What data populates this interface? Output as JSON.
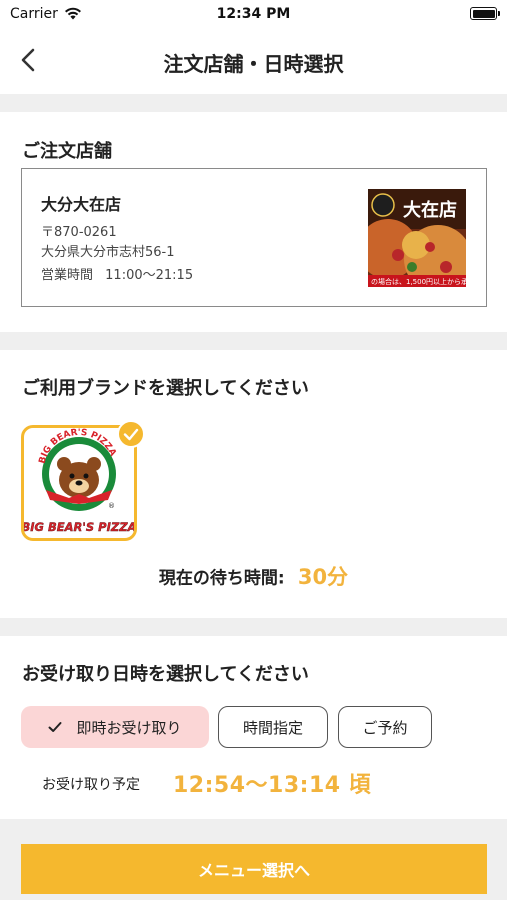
{
  "status_bar": {
    "carrier": "Carrier",
    "time": "12:34 PM"
  },
  "nav": {
    "title": "注文店舗・日時選択",
    "back_icon": "chevron-left-icon"
  },
  "store_section": {
    "title": "ご注文店舗",
    "store": {
      "name": "大分大在店",
      "postal_code": "〒870-0261",
      "address": "大分県大分市志村56-1",
      "hours_label": "営業時間",
      "hours": "11:00〜21:15",
      "image_caption": "大在店",
      "image_banner": "の場合は、1,500円以上から承"
    }
  },
  "brand_section": {
    "title": "ご利用ブランドを選択してください",
    "brands": [
      {
        "name": "BIG BEAR'S PIZZA",
        "arc_text": "BIG BEAR'S PIZZA",
        "selected": true
      }
    ],
    "wait_label": "現在の待ち時間:",
    "wait_value": "30分"
  },
  "pickup_section": {
    "title": "お受け取り日時を選択してください",
    "options": [
      {
        "label": "即時お受け取り",
        "selected": true
      },
      {
        "label": "時間指定",
        "selected": false
      },
      {
        "label": "ご予約",
        "selected": false
      }
    ],
    "eta_label": "お受け取り予定",
    "eta_value": "12:54〜13:14 頃"
  },
  "footer": {
    "cta_label": "メニュー選択へ"
  },
  "colors": {
    "accent": "#f5b82e",
    "accent_text": "#f2b33d",
    "selected_bg": "#fbd6d6",
    "divider": "#efefef",
    "brand_red": "#d8232a",
    "brand_green": "#1a8b3a"
  }
}
